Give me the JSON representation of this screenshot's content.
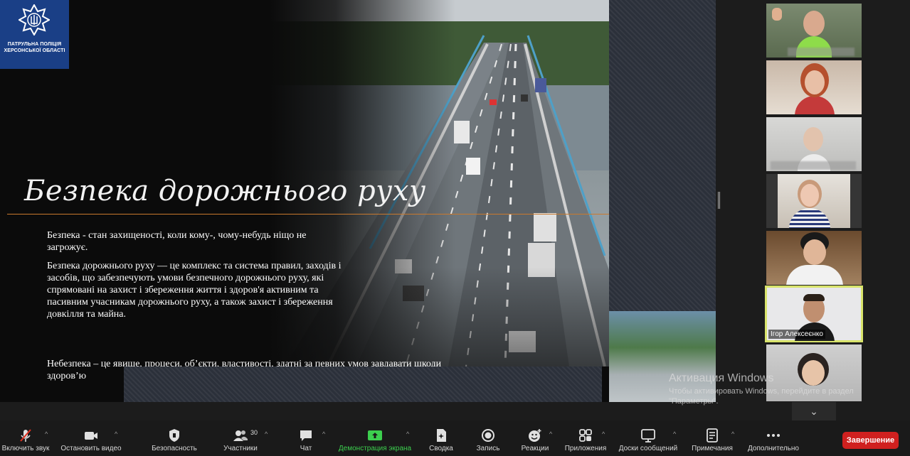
{
  "logo": {
    "line1": "ПАТРУЛЬНА ПОЛІЦІЯ",
    "line2": "ХЕРСОНСЬКОЇ ОБЛАСТІ"
  },
  "slide": {
    "title": "Безпека дорожнього руху",
    "paragraph1": "Безпека - стан захищеності, коли кому-, чому-небудь ніщо не загрожує.",
    "paragraph2": "Безпека дорожнього руху — це комплекс та система правил, заходів і засобів, що забезпечують умови безпечного дорожнього руху, які спрямовані на захист і збереження життя і здоров'я активним та пасивним учасникам дорожнього руху, а також захист і збереження довкілля та майна.",
    "paragraph3": "Небезпека – це явище, процеси, об’єкти, властивості, здатні за певних умов завдавати шкоди здоров’ю"
  },
  "gallery": {
    "participants": [
      {
        "name": ""
      },
      {
        "name": ""
      },
      {
        "name": ""
      },
      {
        "name": ""
      },
      {
        "name": ""
      },
      {
        "name": "Ігор Алексеєнко"
      },
      {
        "name": ""
      }
    ],
    "active_color": "#d8e36a"
  },
  "watermark": {
    "title": "Активация Windows",
    "subtitle": "Чтобы активировать Windows, перейдите в раздел \"Параметры\"."
  },
  "toolbar": {
    "mute": "Включить звук",
    "video": "Остановить видео",
    "security": "Безопасность",
    "participants": "Участники",
    "participants_count": "30",
    "chat": "Чат",
    "share": "Демонстрация экрана",
    "summary": "Сводка",
    "record": "Запись",
    "reactions": "Реакции",
    "apps": "Приложения",
    "whiteboards": "Доски сообщений",
    "notes": "Примечания",
    "more": "Дополнительно",
    "end": "Завершение",
    "share_color": "#3ccf4e",
    "end_color": "#d0201f"
  }
}
